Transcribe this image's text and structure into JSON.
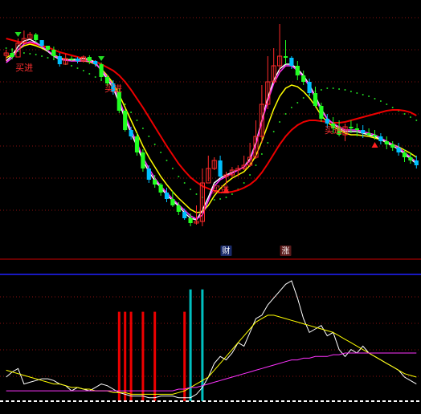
{
  "chart_data": [
    {
      "type": "candlestick",
      "panel": "price",
      "grid": true,
      "grid_style": "dotted red horizontal",
      "colors": {
        "background": "#000000",
        "up_candle": "#ff2a2a",
        "down_candle_light": "#22ff22",
        "down_candle_dark": "#00c0ff",
        "ma_white": "#ffffff",
        "ma_yellow": "#ffff00",
        "ma_magenta": "#ff33ff",
        "ma_red": "#ee0000",
        "dots": "#22dd22"
      },
      "x_count": 70,
      "candles": [
        [
          59,
          56,
          66,
          52
        ],
        [
          56,
          61,
          64,
          50
        ],
        [
          61,
          44,
          47,
          38
        ],
        [
          44,
          38,
          41,
          28
        ],
        [
          38,
          33,
          37,
          30
        ],
        [
          33,
          40,
          43,
          31
        ],
        [
          40,
          47,
          49,
          43
        ],
        [
          47,
          52,
          54,
          47
        ],
        [
          52,
          60,
          63,
          48
        ],
        [
          60,
          70,
          73,
          56
        ],
        [
          70,
          63,
          70,
          57
        ],
        [
          63,
          63,
          66,
          60
        ],
        [
          63,
          66,
          69,
          61
        ],
        [
          66,
          61,
          68,
          59
        ],
        [
          61,
          66,
          70,
          59
        ],
        [
          66,
          70,
          73,
          65
        ],
        [
          70,
          86,
          90,
          68
        ],
        [
          86,
          94,
          96,
          83
        ],
        [
          94,
          104,
          108,
          90
        ],
        [
          104,
          128,
          131,
          100
        ],
        [
          128,
          152,
          154,
          126
        ],
        [
          152,
          160,
          164,
          148
        ],
        [
          160,
          180,
          184,
          156
        ],
        [
          180,
          200,
          204,
          176
        ],
        [
          200,
          214,
          218,
          196
        ],
        [
          214,
          220,
          224,
          208
        ],
        [
          220,
          230,
          234,
          218
        ],
        [
          230,
          238,
          242,
          224
        ],
        [
          238,
          246,
          248,
          228
        ],
        [
          246,
          254,
          258,
          242
        ],
        [
          254,
          262,
          264,
          250
        ],
        [
          262,
          268,
          272,
          256
        ],
        [
          268,
          266,
          270,
          246
        ],
        [
          266,
          218,
          272,
          200
        ],
        [
          218,
          200,
          216,
          184
        ],
        [
          200,
          190,
          202,
          186
        ],
        [
          190,
          210,
          212,
          184
        ],
        [
          210,
          208,
          220,
          204
        ],
        [
          208,
          202,
          212,
          198
        ],
        [
          202,
          200,
          210,
          196
        ],
        [
          200,
          196,
          202,
          184
        ],
        [
          196,
          186,
          198,
          168
        ],
        [
          186,
          160,
          188,
          140
        ],
        [
          160,
          120,
          168,
          96
        ],
        [
          120,
          92,
          126,
          60
        ],
        [
          92,
          72,
          94,
          50
        ],
        [
          72,
          60,
          80,
          20
        ],
        [
          60,
          62,
          70,
          40
        ],
        [
          62,
          72,
          76,
          60
        ],
        [
          72,
          84,
          90,
          66
        ],
        [
          84,
          92,
          96,
          78
        ],
        [
          92,
          106,
          110,
          88
        ],
        [
          106,
          122,
          124,
          98
        ],
        [
          122,
          138,
          142,
          118
        ],
        [
          138,
          144,
          150,
          132
        ],
        [
          144,
          150,
          156,
          136
        ],
        [
          150,
          158,
          160,
          140
        ],
        [
          158,
          148,
          166,
          144
        ],
        [
          148,
          150,
          156,
          140
        ],
        [
          150,
          152,
          160,
          144
        ],
        [
          152,
          156,
          162,
          146
        ],
        [
          156,
          158,
          160,
          150
        ],
        [
          158,
          160,
          164,
          152
        ],
        [
          160,
          166,
          170,
          156
        ],
        [
          166,
          170,
          176,
          160
        ],
        [
          170,
          174,
          178,
          166
        ],
        [
          174,
          180,
          184,
          168
        ],
        [
          180,
          186,
          192,
          176
        ],
        [
          186,
          190,
          194,
          180
        ],
        [
          190,
          196,
          200,
          184
        ]
      ],
      "ma_white": [
        66,
        59,
        48,
        41,
        39,
        43,
        48,
        54,
        60,
        64,
        65,
        64,
        64,
        63,
        64,
        68,
        78,
        89,
        100,
        118,
        138,
        156,
        172,
        190,
        204,
        215,
        224,
        233,
        240,
        247,
        255,
        262,
        264,
        252,
        236,
        218,
        212,
        208,
        205,
        202,
        198,
        188,
        168,
        140,
        112,
        90,
        76,
        70,
        70,
        76,
        84,
        96,
        110,
        126,
        138,
        144,
        150,
        154,
        154,
        154,
        156,
        158,
        160,
        164,
        168,
        172,
        176,
        182,
        188,
        194
      ],
      "ma_yellow": [
        62,
        58,
        52,
        47,
        45,
        47,
        50,
        54,
        58,
        62,
        64,
        65,
        66,
        66,
        67,
        70,
        76,
        84,
        94,
        108,
        124,
        140,
        156,
        172,
        186,
        198,
        210,
        220,
        229,
        237,
        244,
        251,
        255,
        254,
        246,
        234,
        225,
        218,
        212,
        208,
        204,
        196,
        184,
        166,
        146,
        126,
        110,
        100,
        96,
        98,
        104,
        112,
        122,
        134,
        142,
        148,
        152,
        156,
        158,
        158,
        159,
        160,
        162,
        164,
        167,
        170,
        173,
        177,
        181,
        186
      ],
      "ma_magenta": [
        68,
        62,
        52,
        45,
        42,
        44,
        48,
        53,
        59,
        63,
        65,
        66,
        66,
        66,
        66,
        69,
        77,
        86,
        97,
        114,
        134,
        152,
        168,
        186,
        200,
        212,
        222,
        230,
        238,
        245,
        252,
        259,
        263,
        258,
        240,
        222,
        214,
        210,
        206,
        202,
        198,
        190,
        170,
        142,
        116,
        94,
        80,
        72,
        72,
        78,
        86,
        98,
        112,
        128,
        138,
        144,
        148,
        152,
        152,
        152,
        154,
        156,
        158,
        162,
        166,
        170,
        174,
        180,
        186,
        192
      ],
      "ma_red": [
        38,
        40,
        42,
        43,
        44,
        45,
        47,
        49,
        52,
        55,
        57,
        59,
        61,
        63,
        65,
        67,
        70,
        74,
        78,
        84,
        92,
        102,
        113,
        124,
        136,
        148,
        160,
        172,
        183,
        194,
        203,
        211,
        217,
        222,
        225,
        228,
        230,
        230,
        229,
        227,
        224,
        220,
        214,
        205,
        194,
        182,
        170,
        160,
        152,
        146,
        142,
        140,
        140,
        141,
        142,
        143,
        143,
        142,
        140,
        138,
        136,
        134,
        132,
        130,
        128,
        127,
        127,
        128,
        130,
        134
      ],
      "dots": [
        50,
        52,
        54,
        56,
        57,
        58,
        60,
        62,
        64,
        67,
        70,
        72,
        75,
        78,
        82,
        86,
        90,
        96,
        102,
        110,
        120,
        130,
        140,
        150,
        160,
        170,
        180,
        190,
        200,
        210,
        218,
        226,
        232,
        236,
        238,
        239,
        238,
        236,
        232,
        226,
        218,
        208,
        196,
        182,
        168,
        154,
        142,
        132,
        124,
        118,
        112,
        108,
        104,
        102,
        100,
        100,
        101,
        102,
        104,
        106,
        108,
        110,
        113,
        116,
        120,
        124,
        128,
        132,
        136,
        140
      ],
      "buy_signals": [
        {
          "i": 1,
          "label": "买进"
        },
        {
          "i": 16,
          "label": "买进"
        },
        {
          "i": 34,
          "label": "买进"
        },
        {
          "i": 53,
          "label": "买进"
        }
      ],
      "sell_markers": [
        2,
        16
      ],
      "up_markers": [
        37,
        62
      ],
      "badges": [
        {
          "i": 37,
          "text": "财"
        },
        {
          "i": 47,
          "text": "涨"
        }
      ]
    },
    {
      "type": "line",
      "panel": "indicator",
      "grid": true,
      "grid_style": "dotted red horizontal",
      "series": [
        {
          "color": "#ffffff",
          "values": [
            14,
            17,
            19,
            10,
            11,
            12,
            13,
            13,
            12,
            10,
            9,
            6,
            8,
            7,
            6,
            8,
            10,
            9,
            7,
            5,
            4,
            3,
            3,
            3,
            2,
            2,
            3,
            3,
            3,
            2,
            2,
            2,
            4,
            8,
            14,
            22,
            26,
            24,
            28,
            34,
            32,
            40,
            48,
            50,
            56,
            60,
            64,
            68,
            70,
            60,
            48,
            40,
            42,
            44,
            38,
            40,
            30,
            26,
            30,
            28,
            32,
            28,
            26,
            24,
            22,
            20,
            18,
            14,
            12,
            10
          ]
        },
        {
          "color": "#ffff00",
          "values": [
            18,
            17,
            16,
            15,
            14,
            13,
            12,
            11,
            10,
            10,
            9,
            8,
            8,
            7,
            7,
            6,
            6,
            6,
            5,
            5,
            5,
            4,
            4,
            4,
            4,
            4,
            4,
            4,
            4,
            5,
            6,
            8,
            10,
            12,
            14,
            18,
            22,
            26,
            30,
            34,
            38,
            42,
            46,
            48,
            50,
            50,
            49,
            48,
            47,
            46,
            45,
            44,
            43,
            42,
            41,
            40,
            38,
            36,
            34,
            32,
            30,
            28,
            26,
            24,
            22,
            20,
            18,
            16,
            15,
            14
          ]
        },
        {
          "color": "#ff33ff",
          "values": [
            6,
            6,
            6,
            6,
            6,
            6,
            6,
            6,
            6,
            6,
            6,
            6,
            6,
            6,
            6,
            6,
            6,
            6,
            6,
            6,
            6,
            6,
            6,
            6,
            6,
            6,
            6,
            6,
            6,
            7,
            7,
            8,
            8,
            9,
            10,
            11,
            12,
            13,
            14,
            15,
            16,
            17,
            18,
            19,
            20,
            21,
            22,
            23,
            24,
            24,
            25,
            25,
            26,
            26,
            26,
            27,
            27,
            28,
            28,
            28,
            28,
            28,
            28,
            28,
            28,
            28,
            28,
            28,
            28,
            28
          ]
        }
      ],
      "bars": [
        {
          "i": 19,
          "value": 52,
          "color": "#ee0000"
        },
        {
          "i": 20,
          "value": 52,
          "color": "#ee0000"
        },
        {
          "i": 21,
          "value": 52,
          "color": "#ee0000"
        },
        {
          "i": 23,
          "value": 52,
          "color": "#ee0000"
        },
        {
          "i": 25,
          "value": 52,
          "color": "#ee0000"
        },
        {
          "i": 30,
          "value": 52,
          "color": "#ee0000"
        },
        {
          "i": 31,
          "value": 65,
          "color": "#00c0c0"
        },
        {
          "i": 33,
          "value": 65,
          "color": "#00c0c0"
        }
      ]
    }
  ]
}
